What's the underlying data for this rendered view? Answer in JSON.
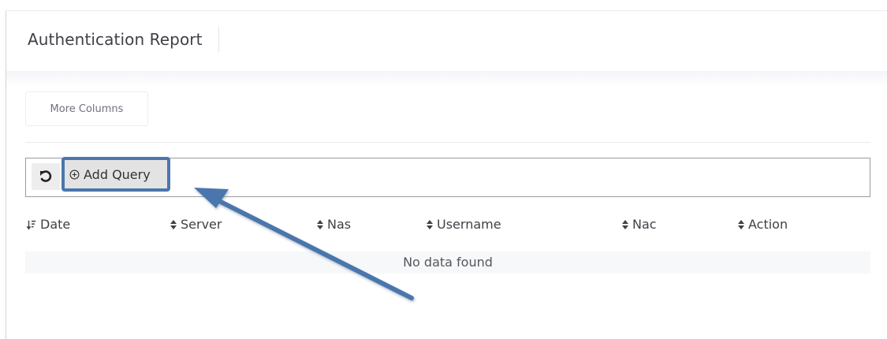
{
  "header": {
    "title": "Authentication Report"
  },
  "toolbar": {
    "more_columns_label": "More Columns"
  },
  "query": {
    "add_query_label": "Add Query"
  },
  "table": {
    "columns": [
      {
        "label": "Date",
        "sort": "active-desc"
      },
      {
        "label": "Server",
        "sort": "unsorted"
      },
      {
        "label": "Nas",
        "sort": "unsorted"
      },
      {
        "label": "Username",
        "sort": "unsorted"
      },
      {
        "label": "Nac",
        "sort": "unsorted"
      },
      {
        "label": "Action",
        "sort": "unsorted"
      }
    ],
    "empty_text": "No data found"
  },
  "annotation": {
    "highlight_color": "#4a76ad"
  }
}
